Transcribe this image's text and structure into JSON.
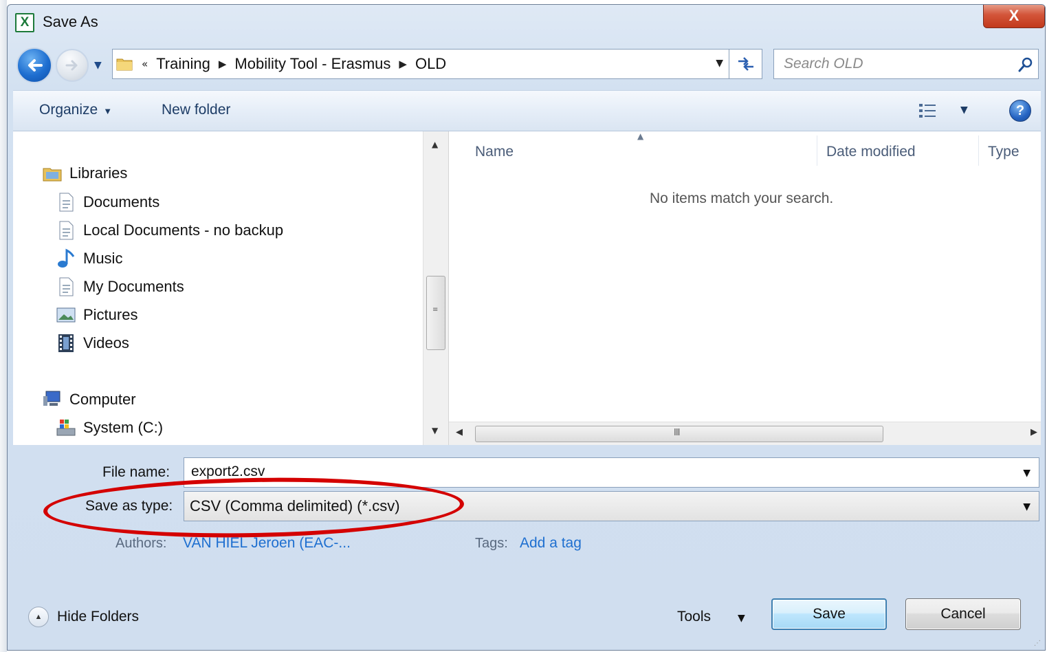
{
  "window": {
    "title": "Save As",
    "app_icon": "excel-icon",
    "close_label": "X"
  },
  "nav": {
    "breadcrumb_prefix": "«",
    "breadcrumbs": [
      "Training",
      "Mobility Tool - Erasmus",
      "OLD"
    ],
    "search_placeholder": "Search OLD"
  },
  "toolbar": {
    "organize_label": "Organize",
    "new_folder_label": "New folder",
    "help_label": "?"
  },
  "sidebar": {
    "libraries_label": "Libraries",
    "items": [
      {
        "label": "Documents",
        "icon": "document-icon"
      },
      {
        "label": "Local Documents - no backup",
        "icon": "document-icon"
      },
      {
        "label": "Music",
        "icon": "music-icon"
      },
      {
        "label": "My Documents",
        "icon": "document-icon"
      },
      {
        "label": "Pictures",
        "icon": "pictures-icon"
      },
      {
        "label": "Videos",
        "icon": "videos-icon"
      }
    ],
    "computer_label": "Computer",
    "drives": [
      {
        "label": "System (C:)",
        "icon": "drive-icon"
      }
    ]
  },
  "content": {
    "columns": [
      "Name",
      "Date modified",
      "Type"
    ],
    "empty_message": "No items match your search."
  },
  "form": {
    "file_name_label": "File name:",
    "file_name_value": "export2.csv",
    "save_as_type_label": "Save as type:",
    "save_as_type_value": "CSV (Comma delimited) (*.csv)",
    "authors_label": "Authors:",
    "authors_value": "VAN HIEL Jeroen (EAC-...",
    "tags_label": "Tags:",
    "tags_value": "Add a tag"
  },
  "footer": {
    "hide_folders_label": "Hide Folders",
    "tools_label": "Tools",
    "save_label": "Save",
    "cancel_label": "Cancel"
  },
  "colors": {
    "highlight": "#d40000",
    "link": "#1e6fd0"
  }
}
